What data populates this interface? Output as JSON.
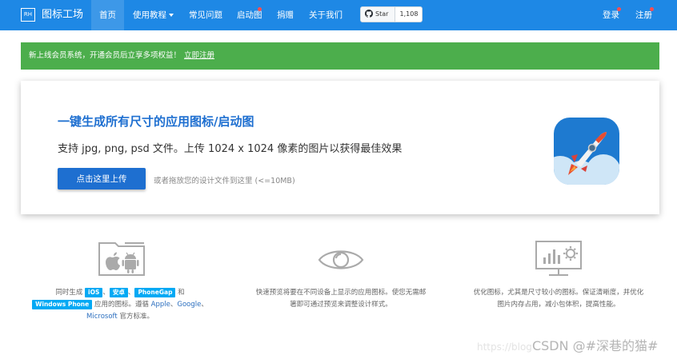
{
  "nav": {
    "logo": "RH",
    "brand": "图标工场",
    "items": [
      {
        "label": "首页"
      },
      {
        "label": "使用教程"
      },
      {
        "label": "常见问题"
      },
      {
        "label": "启动图"
      },
      {
        "label": "捐赠"
      },
      {
        "label": "关于我们"
      }
    ],
    "github": {
      "star_label": "Star",
      "count": "1,108"
    },
    "login": "登录",
    "register": "注册"
  },
  "alert": {
    "text": "新上线会员系统，开通会员后立享多项权益！",
    "link": "立即注册"
  },
  "hero": {
    "title": "一键生成所有尺寸的应用图标/启动图",
    "subtitle": "支持 jpg, png, psd 文件。上传 1024 x 1024 像素的图片以获得最佳效果",
    "button": "点击这里上传",
    "hint": "或者拖放您的设计文件到这里 (<=10MB)"
  },
  "features": {
    "f1": {
      "p1": "同时生成",
      "tag_ios": "iOS",
      "sep1": "、",
      "tag_android": "安卓",
      "sep2": "、",
      "tag_phonegap": "PhoneGap",
      "p2": "和",
      "tag_wp": "Windows Phone",
      "p3": "应用的图标。遵循",
      "link_apple": "Apple",
      "sep3": "、",
      "link_google": "Google",
      "sep4": "、",
      "link_ms": "Microsoft",
      "p4": "官方标准。"
    },
    "f2": {
      "line1": "快速预览将要在不同设备上显示的应用图标。使您无需邮",
      "line2": "箸即可通过预览来调整设计样式。"
    },
    "f3": {
      "line1": "优化图标，尤其是尺寸较小的图标。保证清晰度，并优化",
      "line2": "图片内存占用，减小包体积，提高性能。"
    }
  },
  "watermark": {
    "faint": "https://blog",
    "text": "CSDN @#深巷的猫#"
  },
  "colors": {
    "nav": "#1e88e5",
    "alert": "#4cae4c",
    "primary": "#1e6fd0",
    "tag": "#03a9f4"
  }
}
